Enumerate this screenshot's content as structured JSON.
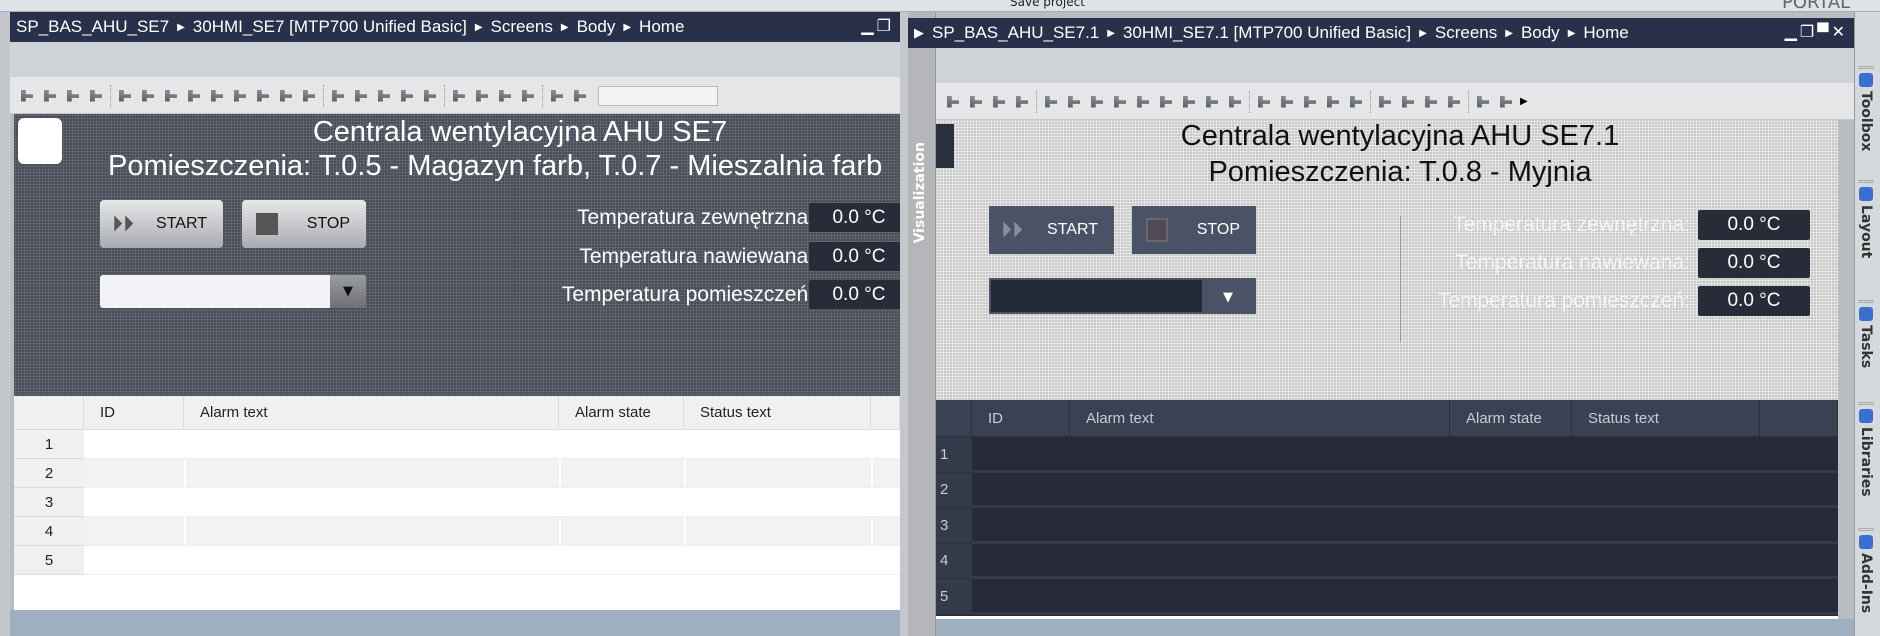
{
  "top": {
    "save_project": "Save project",
    "portal": "PORTAL"
  },
  "toolbar_icons": [
    "magic-wand-icon",
    "rotate-right-icon",
    "rotate-left-icon",
    "rotate-icon",
    "sep",
    "align-left-icon",
    "align-center-icon",
    "align-right-icon",
    "align-top-icon",
    "align-middle-icon",
    "align-bottom-icon",
    "center-icon",
    "center-horizontal-icon",
    "center-vertical-icon",
    "sep",
    "distribute-horizontal-icon",
    "distribute-vertical-icon",
    "same-height-icon",
    "same-width-icon",
    "same-size-icon",
    "sep",
    "bring-front-icon",
    "bring-forward-icon",
    "send-backward-icon",
    "send-back-icon",
    "sep",
    "move-up-icon",
    "move-down-icon"
  ],
  "left": {
    "breadcrumb": [
      "SP_BAS_AHU_SE7",
      "30HMI_SE7 [MTP700 Unified Basic]",
      "Screens",
      "Body",
      "Home"
    ],
    "title1": "Centrala wentylacyjna AHU SE7",
    "title2": "Pomieszczenia: T.0.5 - Magazyn farb, T.0.7 - Mieszalnia farb",
    "start": "START",
    "stop": "STOP",
    "temps": [
      {
        "label": "Temperatura zewnętrzna:",
        "value": "0.0 °C"
      },
      {
        "label": "Temperatura nawiewana:",
        "value": "0.0 °C"
      },
      {
        "label": "Temperatura pomieszczeń:",
        "value": "0.0 °C"
      }
    ],
    "columns": [
      "ID",
      "Alarm text",
      "Alarm state",
      "Status text"
    ],
    "rows": [
      "1",
      "2",
      "3",
      "4",
      "5"
    ]
  },
  "right": {
    "breadcrumb": [
      "SP_BAS_AHU_SE7.1",
      "30HMI_SE7.1 [MTP700 Unified Basic]",
      "Screens",
      "Body",
      "Home"
    ],
    "title1": "Centrala wentylacyjna AHU SE7.1",
    "title2": "Pomieszczenia: T.0.8 - Myjnia",
    "start": "START",
    "stop": "STOP",
    "temps": [
      {
        "label": "Temperatura zewnętrzna:",
        "value": "0.0 °C"
      },
      {
        "label": "Temperatura nawiewana:",
        "value": "0.0 °C"
      },
      {
        "label": "Temperatura pomieszczeń:",
        "value": "0.0 °C"
      }
    ],
    "columns": [
      "ID",
      "Alarm text",
      "Alarm state",
      "Status text"
    ],
    "rows": [
      "1",
      "2",
      "3",
      "4",
      "5"
    ]
  },
  "side_tab": "Visualization",
  "task_cards": [
    "Toolbox",
    "Layout",
    "Tasks",
    "Libraries",
    "Add-Ins"
  ]
}
